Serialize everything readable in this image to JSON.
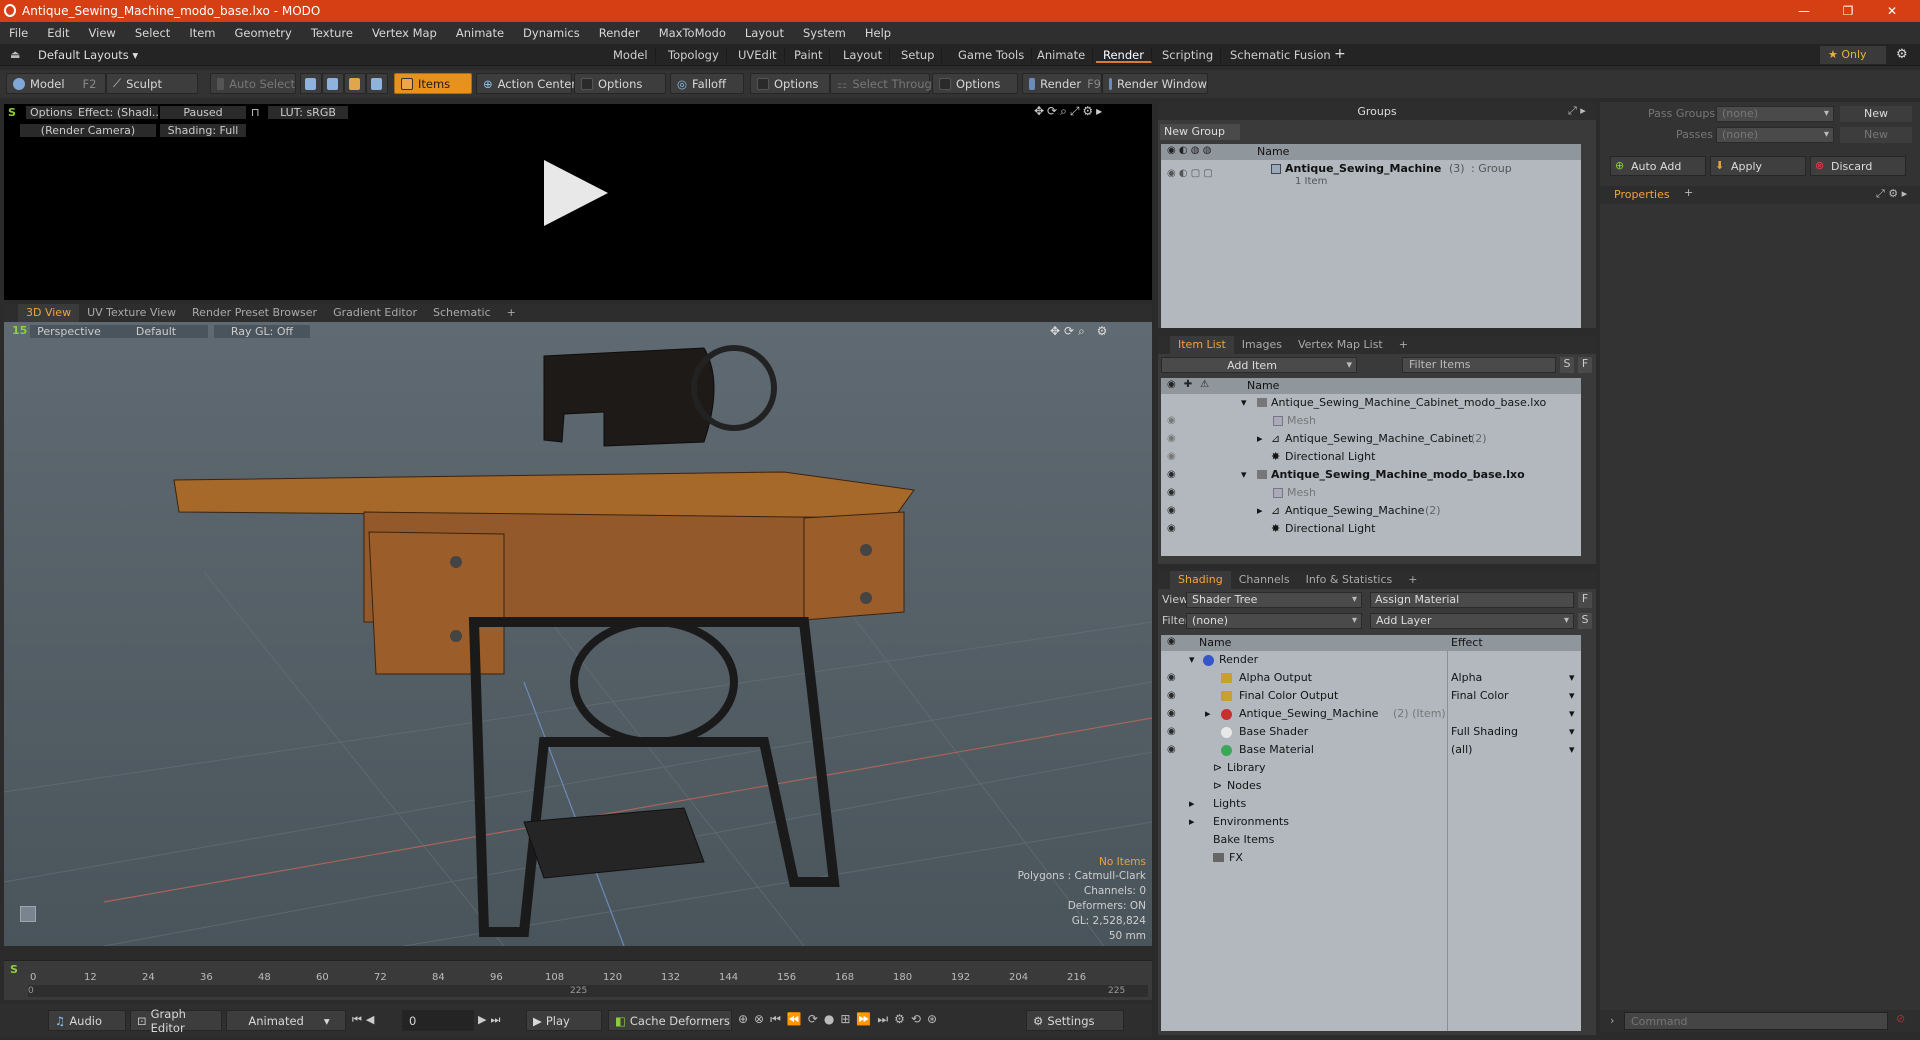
{
  "window": {
    "title": "Antique_Sewing_Machine_modo_base.lxo - MODO",
    "controls": [
      "—",
      "❐",
      "✕"
    ]
  },
  "menu": [
    "File",
    "Edit",
    "View",
    "Select",
    "Item",
    "Geometry",
    "Texture",
    "Vertex Map",
    "Animate",
    "Dynamics",
    "Render",
    "MaxToModo",
    "Layout",
    "System",
    "Help"
  ],
  "layoutbar": {
    "layouts_label": "Default Layouts ▾",
    "tabs": [
      "Model",
      "Topology",
      "UVEdit",
      "Paint",
      "Layout",
      "Setup",
      "Game Tools",
      "Animate",
      "Render",
      "Scripting",
      "Schematic Fusion"
    ],
    "active_tab": "Render",
    "add": "+",
    "only": "★  Only",
    "gear": "⚙"
  },
  "toolbar": {
    "model": "Model",
    "model_key": "F2",
    "sculpt": "Sculpt",
    "auto_select": "Auto Select",
    "items": "Items",
    "action_center": "Action Center",
    "options1": "Options",
    "falloff": "Falloff",
    "options2": "Options",
    "select_through": "Select Through",
    "options3": "Options",
    "render": "Render",
    "render_key": "F9",
    "render_window": "Render Window"
  },
  "render_view": {
    "options": "Options",
    "effect": "Effect: (Shadi...",
    "paused": "Paused",
    "lut": "LUT: sRGB",
    "camera": "(Render Camera)",
    "shading": "Shading: Full"
  },
  "view_tabs": [
    "3D View",
    "UV Texture View",
    "Render Preset Browser",
    "Gradient Editor",
    "Schematic"
  ],
  "viewport": {
    "perspective": "Perspective",
    "default": "Default",
    "raygl": "Ray GL: Off",
    "info": {
      "no_items": "No Items",
      "polygons": "Polygons : Catmull-Clark",
      "channels": "Channels: 0",
      "deformers": "Deformers: ON",
      "gl": "GL: 2,528,824",
      "focal": "50 mm"
    }
  },
  "timeline": {
    "ticks": [
      "0",
      "12",
      "24",
      "36",
      "48",
      "60",
      "72",
      "84",
      "96",
      "108",
      "120",
      "132",
      "144",
      "156",
      "168",
      "180",
      "192",
      "204",
      "216"
    ],
    "sub_left": "0",
    "sub_mid": "225",
    "sub_right": "225"
  },
  "bottom_bar": {
    "audio": "Audio",
    "graph_editor": "Graph Editor",
    "animated": "Animated",
    "frame": "0",
    "play": "Play",
    "cache_deformers": "Cache Deformers",
    "settings": "Settings"
  },
  "groups": {
    "title": "Groups",
    "new_group": "New Group",
    "col_name": "Name",
    "item_name": "Antique_Sewing_Machine",
    "item_count": "(3)",
    "item_type": ": Group",
    "item_sub": "1 Item"
  },
  "passes": {
    "pass_groups_label": "Pass Groups",
    "pass_groups_value": "(none)",
    "passes_label": "Passes",
    "passes_value": "(none)",
    "new1": "New",
    "new2": "New",
    "auto_add": "Auto Add",
    "apply": "Apply",
    "discard": "Discard",
    "properties": "Properties"
  },
  "item_list": {
    "tabs": [
      "Item List",
      "Images",
      "Vertex Map List"
    ],
    "add_item": "Add Item",
    "filter": "Filter Items",
    "s": "S",
    "f": "F",
    "col_name": "Name",
    "rows": [
      {
        "text": "Antique_Sewing_Machine_Cabinet_modo_base.lxo",
        "suffix": ""
      },
      {
        "text": "Mesh",
        "suffix": ""
      },
      {
        "text": "Antique_Sewing_Machine_Cabinet",
        "suffix": " (2)"
      },
      {
        "text": "Directional Light",
        "suffix": ""
      },
      {
        "text": "Antique_Sewing_Machine_modo_base.lxo",
        "suffix": ""
      },
      {
        "text": "Mesh",
        "suffix": ""
      },
      {
        "text": "Antique_Sewing_Machine",
        "suffix": " (2)"
      },
      {
        "text": "Directional Light",
        "suffix": ""
      }
    ]
  },
  "shading": {
    "tabs": [
      "Shading",
      "Channels",
      "Info & Statistics"
    ],
    "view_label": "View",
    "view_value": "Shader Tree",
    "assign_material": "Assign Material",
    "filter_label": "Filter",
    "filter_value": "(none)",
    "add_layer": "Add Layer",
    "f": "F",
    "s": "S",
    "col_name": "Name",
    "col_effect": "Effect",
    "rows": [
      {
        "name": "Render",
        "suffix": "",
        "effect": ""
      },
      {
        "name": "Alpha Output",
        "suffix": "",
        "effect": "Alpha"
      },
      {
        "name": "Final Color Output",
        "suffix": "",
        "effect": "Final Color"
      },
      {
        "name": "Antique_Sewing_Machine",
        "suffix": " (2) (Item)",
        "effect": ""
      },
      {
        "name": "Base Shader",
        "suffix": "",
        "effect": "Full Shading"
      },
      {
        "name": "Base Material",
        "suffix": "",
        "effect": "(all)"
      },
      {
        "name": "Library",
        "suffix": "",
        "effect": ""
      },
      {
        "name": "Nodes",
        "suffix": "",
        "effect": ""
      },
      {
        "name": "Lights",
        "suffix": "",
        "effect": ""
      },
      {
        "name": "Environments",
        "suffix": "",
        "effect": ""
      },
      {
        "name": "Bake Items",
        "suffix": "",
        "effect": ""
      },
      {
        "name": "FX",
        "suffix": "",
        "effect": ""
      }
    ]
  },
  "command": {
    "placeholder": "Command"
  },
  "colors": {
    "titlebar": "#d63f14",
    "accent_orange": "#e8921e",
    "list_bg": "#b2b8be"
  }
}
